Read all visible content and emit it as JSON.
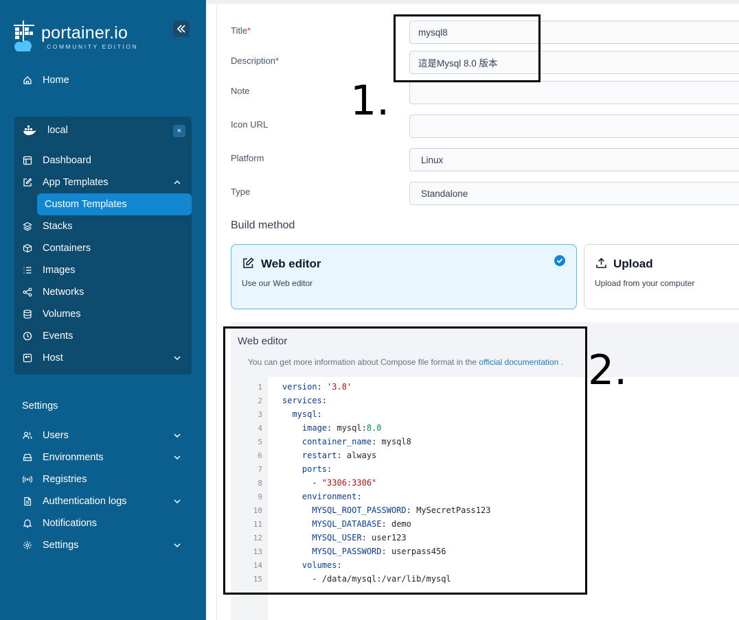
{
  "sidebar": {
    "logo_title": "portainer.io",
    "logo_subtitle": "COMMUNITY EDITION",
    "home": "Home",
    "environment": {
      "name": "local",
      "close": "×",
      "items": [
        "Dashboard",
        "App Templates",
        "Custom Templates",
        "Stacks",
        "Containers",
        "Images",
        "Networks",
        "Volumes",
        "Events",
        "Host"
      ]
    },
    "settings_heading": "Settings",
    "settings_items": [
      "Users",
      "Environments",
      "Registries",
      "Authentication logs",
      "Notifications",
      "Settings"
    ]
  },
  "form": {
    "title_label": "Title",
    "title_value": "mysql8",
    "description_label": "Description",
    "description_value": "這是Mysql 8.0 版本",
    "required_mark": "*",
    "note_label": "Note",
    "note_value": "",
    "icon_url_label": "Icon URL",
    "icon_url_value": "",
    "platform_label": "Platform",
    "platform_value": "Linux",
    "type_label": "Type",
    "type_value": "Standalone"
  },
  "build_method": {
    "heading": "Build method",
    "web_editor_title": "Web editor",
    "web_editor_desc": "Use our Web editor",
    "upload_title": "Upload",
    "upload_desc": "Upload from your computer"
  },
  "editor": {
    "title": "Web editor",
    "help_prefix": "You can get more information about Compose file format in the",
    "help_link": "official documentation",
    "help_suffix": ".",
    "lines": [
      "version: '3.8'",
      "services:",
      "  mysql:",
      "    image: mysql:8.0",
      "    container_name: mysql8",
      "    restart: always",
      "    ports:",
      "      - \"3306:3306\"",
      "    environment:",
      "      MYSQL_ROOT_PASSWORD: MySecretPass123",
      "      MYSQL_DATABASE: demo",
      "      MYSQL_USER: user123",
      "      MYSQL_PASSWORD: userpass456",
      "    volumes:",
      "      - /data/mysql:/var/lib/mysql"
    ]
  },
  "annotations": {
    "first": "1.",
    "second": "2."
  },
  "colors": {
    "sidebar_bg": "#0b5f8f",
    "env_bg": "#0c4a6e",
    "active_item": "#1287cf",
    "selected_card_bg": "#eaf6fd"
  }
}
